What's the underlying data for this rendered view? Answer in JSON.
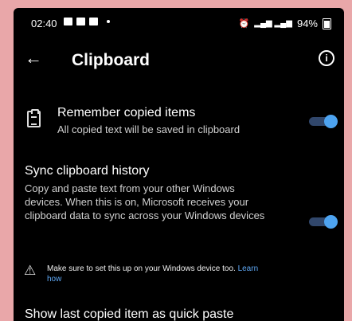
{
  "status_bar": {
    "time": "02:40",
    "signal_text": "\u0001Vo) . ll \u0001Vo) . ll",
    "battery": "94%"
  },
  "app_bar": {
    "title": "Clipboard"
  },
  "remember": {
    "title": "Remember copied items",
    "description": "All copied text will be saved in clipboard",
    "enabled": true
  },
  "sync": {
    "title": "Sync clipboard history",
    "description": "Copy and paste text from your other Windows devices. When this is on, Microsoft receives your clipboard data to sync across your Windows devices",
    "enabled": true,
    "warning_text": "Make sure to set this up on your Windows device too. ",
    "learn_how": "Learn how"
  },
  "quick_paste": {
    "title": "Show last copied item as quick paste"
  },
  "colors": {
    "background": "#000000",
    "toggle_on": "#4da3f0",
    "link": "#5fa8f5",
    "page_border": "#e9a7a9"
  }
}
